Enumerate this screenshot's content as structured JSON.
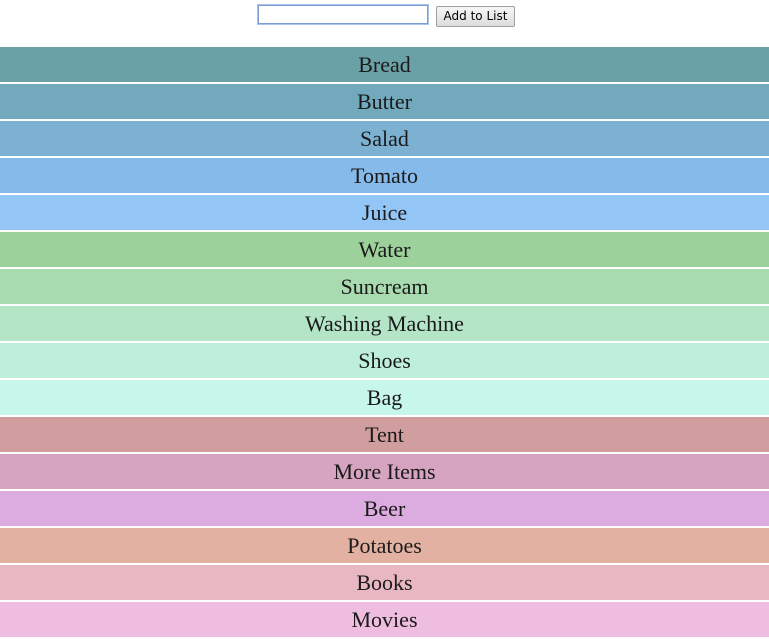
{
  "form": {
    "input_value": "",
    "input_placeholder": "",
    "add_button_label": "Add to List"
  },
  "list": {
    "items": [
      {
        "label": "Bread",
        "color": "#6aa1a6"
      },
      {
        "label": "Butter",
        "color": "#72a9bd"
      },
      {
        "label": "Salad",
        "color": "#7cb1d2"
      },
      {
        "label": "Tomato",
        "color": "#86baea"
      },
      {
        "label": "Juice",
        "color": "#93c5f6"
      },
      {
        "label": "Water",
        "color": "#9dd19c"
      },
      {
        "label": "Suncream",
        "color": "#a9dbb0"
      },
      {
        "label": "Washing Machine",
        "color": "#b4e5c7"
      },
      {
        "label": "Shoes",
        "color": "#bdefda"
      },
      {
        "label": "Bag",
        "color": "#c6f7ea"
      },
      {
        "label": "Tent",
        "color": "#d09e9f"
      },
      {
        "label": "More Items",
        "color": "#d6a4c1"
      },
      {
        "label": "Beer",
        "color": "#dcabe0"
      },
      {
        "label": "Potatoes",
        "color": "#e2b1a1"
      },
      {
        "label": "Books",
        "color": "#e8b7c2"
      },
      {
        "label": "Movies",
        "color": "#eebddf"
      }
    ]
  }
}
